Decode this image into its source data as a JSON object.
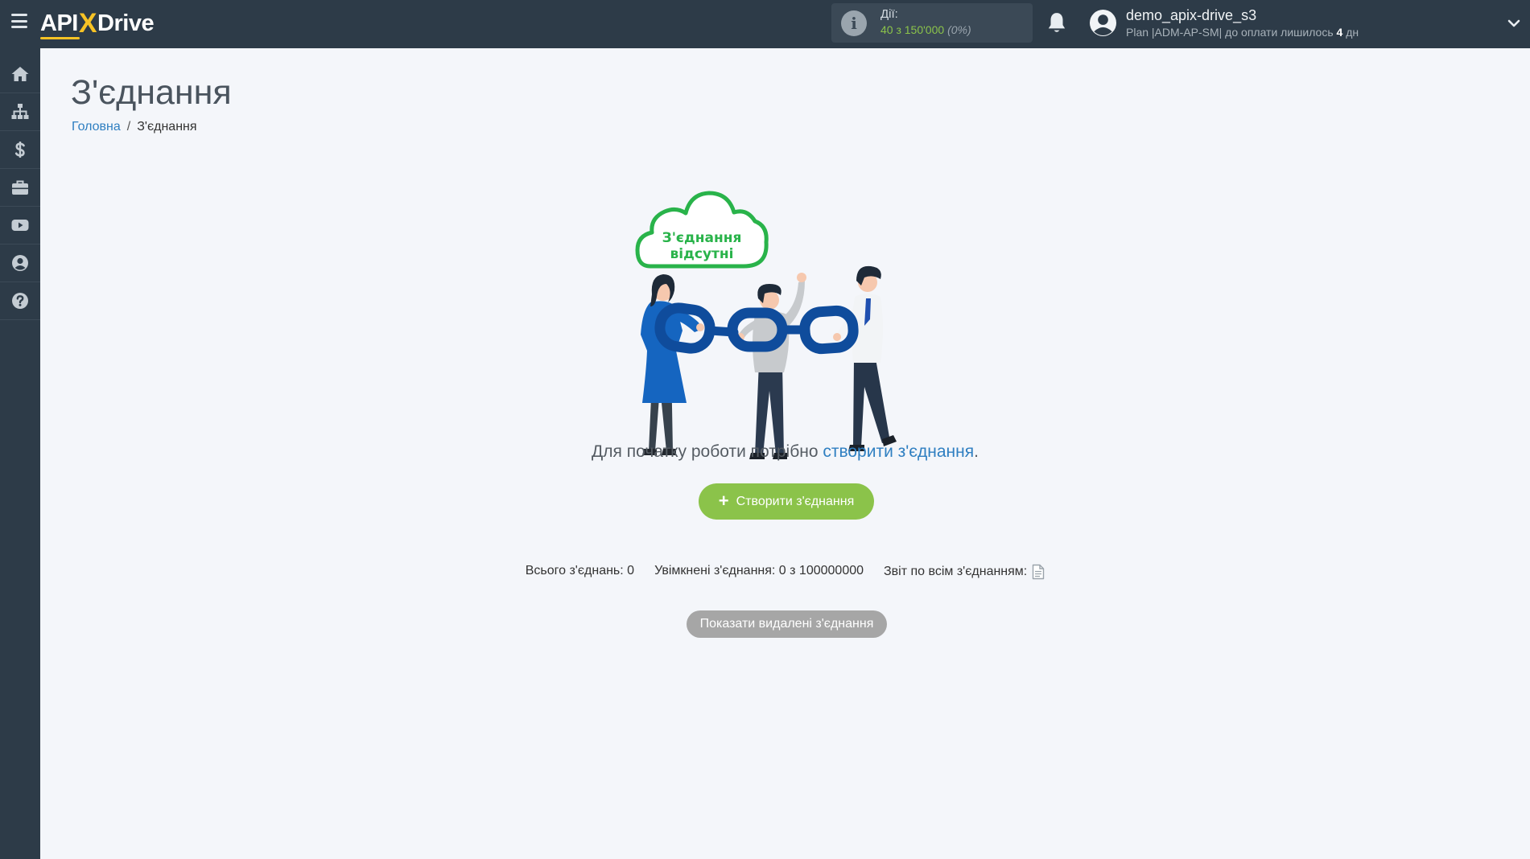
{
  "header": {
    "logo": {
      "api": "API",
      "x": "X",
      "drive": "Drive"
    },
    "actions": {
      "label": "Дії:",
      "count": "40 з 150'000",
      "percent": "(0%)"
    },
    "user": {
      "name": "demo_apix-drive_s3",
      "plan_prefix": "Plan |ADM-AP-SM| до оплати лишилось ",
      "days": "4",
      "days_suffix": " дн"
    }
  },
  "sidebar": {
    "items": [
      {
        "icon": "home-icon"
      },
      {
        "icon": "sitemap-icon"
      },
      {
        "icon": "dollar-icon"
      },
      {
        "icon": "briefcase-icon"
      },
      {
        "icon": "youtube-icon"
      },
      {
        "icon": "user-circle-icon"
      },
      {
        "icon": "question-circle-icon"
      }
    ]
  },
  "page": {
    "title": "З'єднання",
    "breadcrumb": {
      "home": "Головна",
      "separator": "/",
      "current": "З'єднання"
    }
  },
  "empty_state": {
    "cloud_line1": "З'єднання",
    "cloud_line2": "відсутні",
    "hint_prefix": "Для початку роботи потрібно ",
    "hint_link": "створити з'єднання",
    "hint_suffix": ".",
    "create_button": "Створити з'єднання"
  },
  "stats": {
    "total": "Всього з'єднань: 0",
    "enabled": "Увімкнені з'єднання: 0 з 100000000",
    "report": "Звіт по всім з'єднанням:"
  },
  "show_deleted_button": "Показати видалені з'єднання",
  "colors": {
    "topbar": "#2d3b48",
    "accent_green": "#8bc34a",
    "link_blue": "#2f7fc1",
    "logo_yellow": "#f7c325",
    "chain_blue": "#0f4c9c",
    "cloud_green": "#29b34a"
  }
}
